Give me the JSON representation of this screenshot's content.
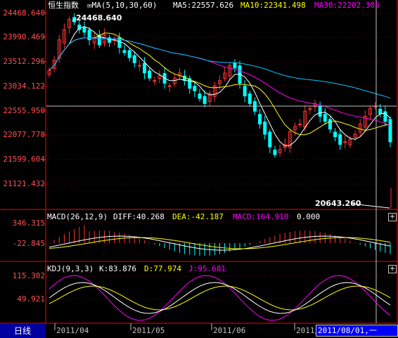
{
  "top": {
    "index_name": "恒生指数",
    "ma_params": "MA(5,10,30,60)",
    "ma5": "MA5:22557.626",
    "ma10": "MA10:22341.498",
    "ma30": "MA30:22202.305"
  },
  "price_axis": [
    "24468.640",
    "23990.469",
    "23512.296",
    "23034.122",
    "22555.950",
    "22077.778",
    "21599.604",
    "21121.432"
  ],
  "annotations": {
    "high": "24468.640",
    "low": "20643.260"
  },
  "macd": {
    "title": "MACD(26,12,9)",
    "diff": "DIFF:40.268",
    "dea": "DEA:-42.187",
    "macd": "MACD:164.910",
    "extra": "0.000",
    "axis_top": "346.315",
    "axis_mid": "-22.845"
  },
  "kdj": {
    "title": "KDJ(9,3,3)",
    "k": "K:83.876",
    "d": "D:77.974",
    "j": "J:95.681",
    "axis_top": "115.302",
    "axis_mid": "49.921"
  },
  "bottom": {
    "period_button": "日线",
    "months": [
      "2011/04",
      "2011/05",
      "2011/06",
      "2011/07"
    ],
    "cursor_date": "2011/08/01,一"
  },
  "colors": {
    "up": "#ff3232",
    "down": "#00ffff",
    "ma5": "#ffffff",
    "ma10": "#ffff00",
    "ma30": "#ff00ff",
    "ma60": "#00c8ff",
    "axis": "#ff0000"
  }
}
